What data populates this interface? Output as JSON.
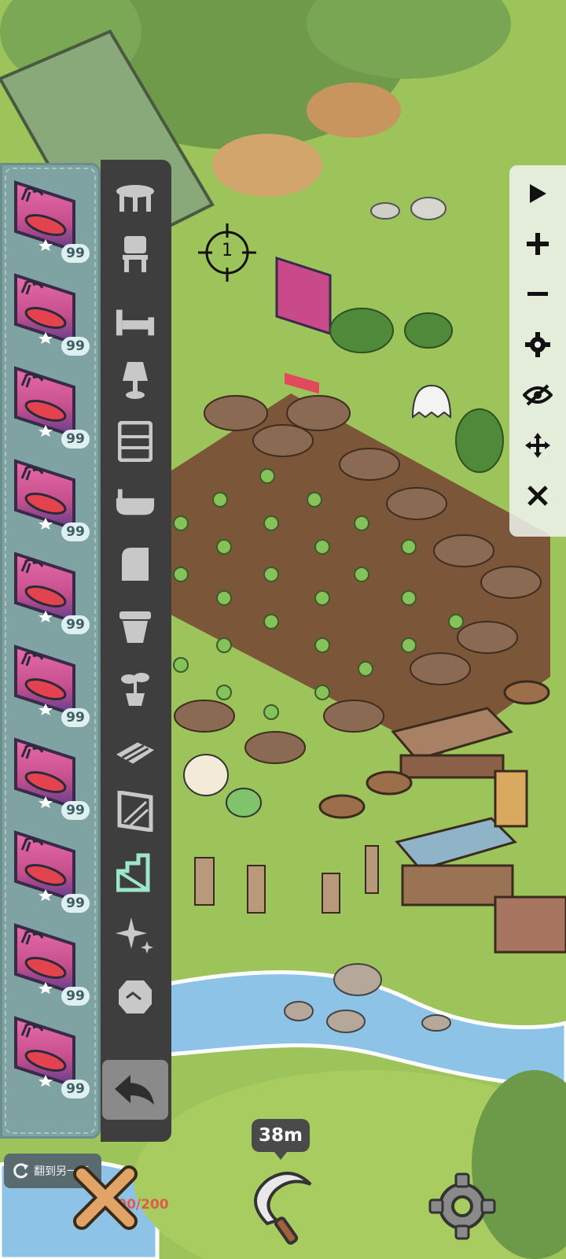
{
  "inventory": {
    "item_name": "sunset-beach-car-poster",
    "items": [
      {
        "count": "99"
      },
      {
        "count": "99"
      },
      {
        "count": "99"
      },
      {
        "count": "99"
      },
      {
        "count": "99"
      },
      {
        "count": "99"
      },
      {
        "count": "99"
      },
      {
        "count": "99"
      },
      {
        "count": "99"
      },
      {
        "count": "99"
      }
    ]
  },
  "categories": [
    "table-icon",
    "chair-icon",
    "bed-icon",
    "lamp-icon",
    "shelf-icon",
    "bathtub-icon",
    "rug-icon",
    "pot-icon",
    "plant-icon",
    "planks-icon",
    "wall-icon",
    "stairs-icon",
    "sparkle-icon",
    "stone-icon"
  ],
  "capacity": "200/200",
  "toolbar": {
    "icons": [
      "play-icon",
      "zoom-in-icon",
      "zoom-out-icon",
      "settings-icon",
      "hide-icon",
      "move-icon",
      "close-icon"
    ]
  },
  "placement_marker": {
    "label": "1"
  },
  "bottom": {
    "flip_label": "翻到另一面",
    "timer": "38m"
  },
  "colors": {
    "panel": "#7fa3a2",
    "category_bg": "#3e3e3e",
    "active_category": "#9ee6c8",
    "capacity_text": "#e05b4a"
  }
}
